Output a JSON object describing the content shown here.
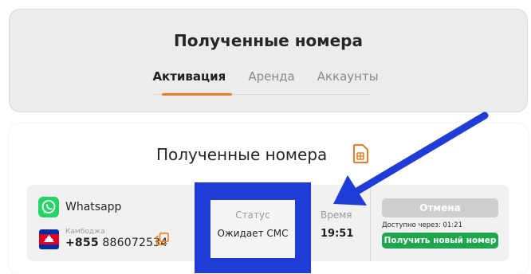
{
  "header": {
    "title": "Полученные номера",
    "tabs": [
      {
        "label": "Активация",
        "active": true
      },
      {
        "label": "Аренда",
        "active": false
      },
      {
        "label": "Аккаунты",
        "active": false
      }
    ]
  },
  "main": {
    "title": "Полученные номера",
    "title_icon": "sim-card-icon"
  },
  "row": {
    "app": {
      "name": "Whatsapp",
      "icon": "whatsapp-icon"
    },
    "country": "Камбоджа",
    "phone_code": "+855",
    "phone_number": "886072534",
    "status_label": "Статус",
    "status_value": "Ожидает СМС",
    "time_label": "Время",
    "time_value": "19:51",
    "cancel_label": "Отмена",
    "available_text": "Доступно через:  01:21",
    "new_number_label": "Получить новый номер"
  },
  "colors": {
    "accent": "#f07e1f",
    "annotation_blue": "#1f3cd6",
    "success_green": "#1da64b",
    "disabled_gray": "#cfcfcf"
  }
}
